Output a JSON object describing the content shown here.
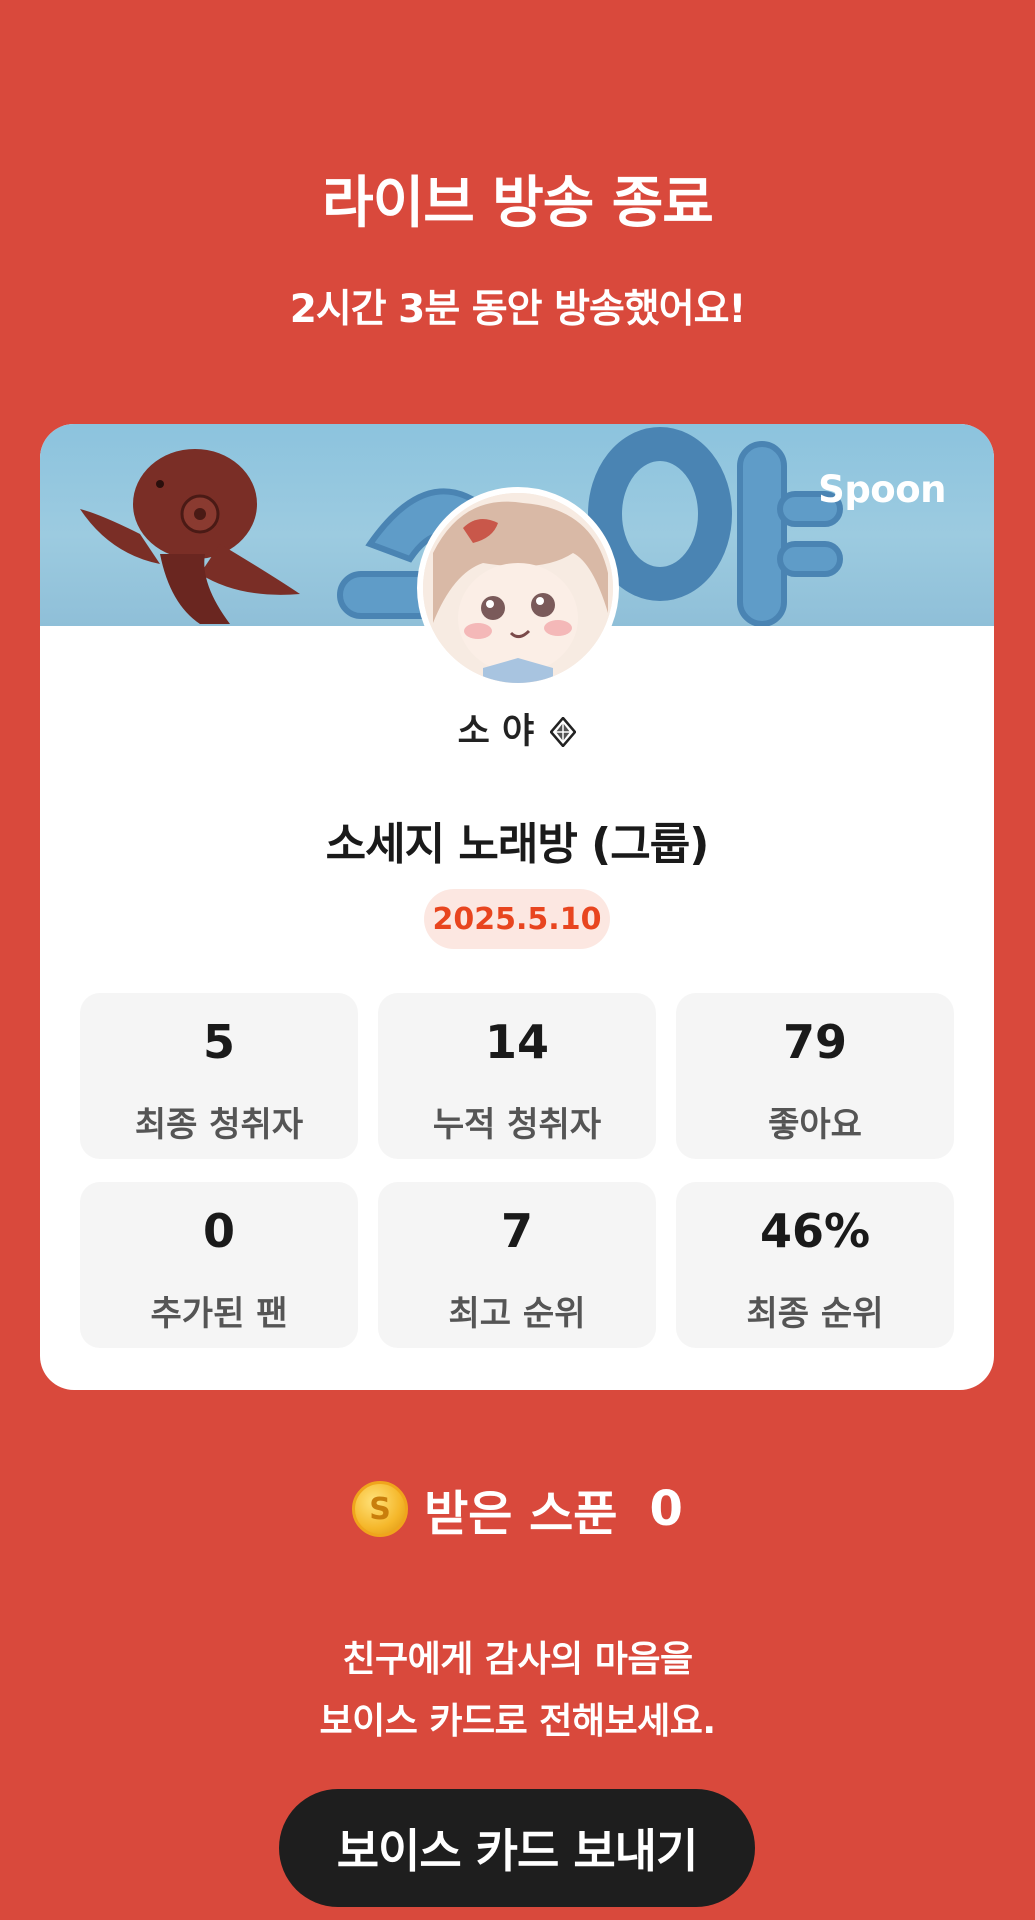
{
  "header": {
    "title": "라이브 방송 종료",
    "subtitle": "2시간 3분 동안 방송했어요!"
  },
  "card": {
    "banner_logo": "Spoon",
    "nickname": "소 야",
    "nickname_badge_icon": "diamond-badge-icon",
    "room_title": "소세지 노래방 (그룹)",
    "date": "2025.5.10",
    "stats": [
      {
        "value": "5",
        "label": "최종 청취자"
      },
      {
        "value": "14",
        "label": "누적 청취자"
      },
      {
        "value": "79",
        "label": "좋아요"
      },
      {
        "value": "0",
        "label": "추가된 팬"
      },
      {
        "value": "7",
        "label": "최고 순위"
      },
      {
        "value": "46%",
        "label": "최종 순위"
      }
    ]
  },
  "spoons": {
    "icon": "coin-icon",
    "label": "받은 스푼",
    "value": "0"
  },
  "message": {
    "line1": "친구에게 감사의 마음을",
    "line2": "보이스 카드로 전해보세요."
  },
  "action": {
    "send_label": "보이스 카드 보내기"
  },
  "colors": {
    "background": "#D9493C",
    "date_text": "#E8451F",
    "button": "#1E1E1E"
  }
}
